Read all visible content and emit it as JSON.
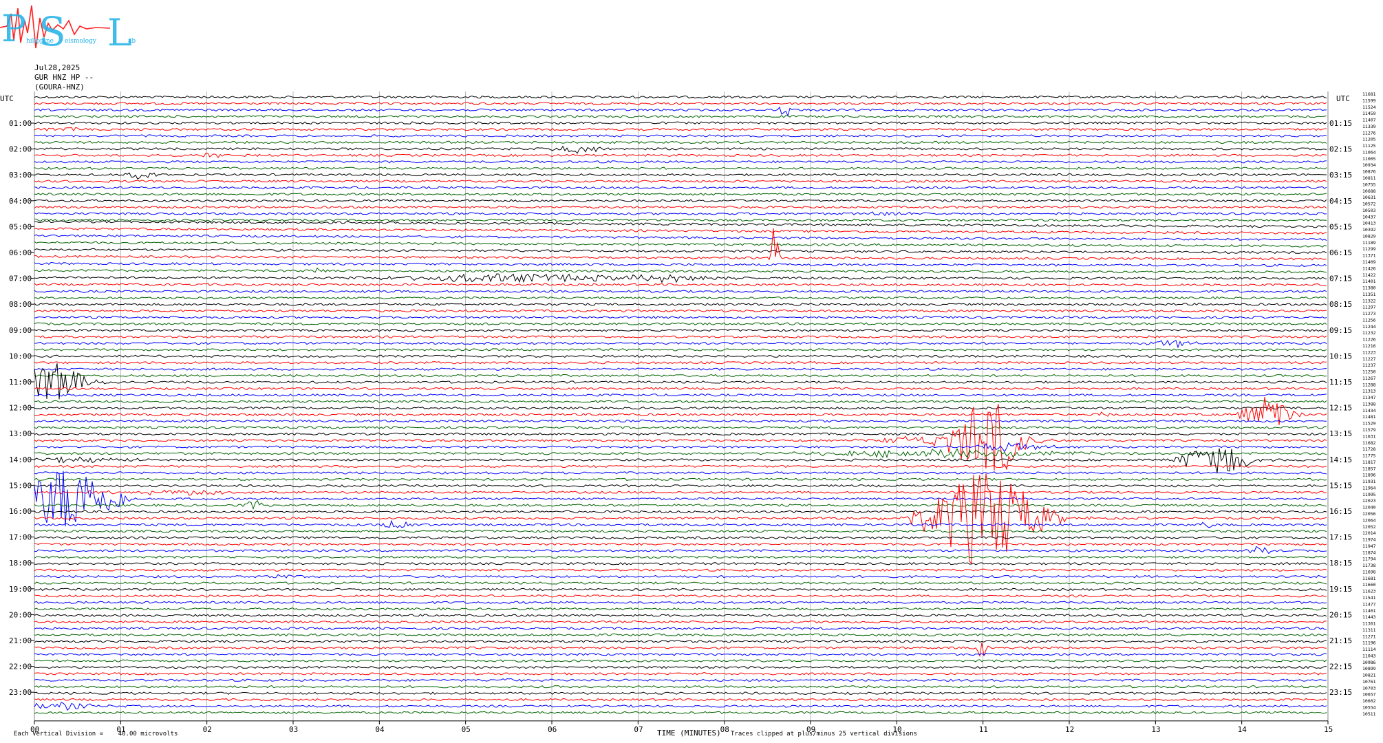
{
  "logo": {
    "letters": [
      "P",
      "S",
      "L"
    ],
    "subtitle_fragments": [
      "hilippine",
      "eismology",
      "ab"
    ]
  },
  "header": {
    "date": "Jul28,2025",
    "channel": "GUR HNZ HP --",
    "station": "(GOURA-HNZ)"
  },
  "footer": {
    "left_note": "Each Vertical Division =    40.00 microvolts",
    "xlabel": "TIME (MINUTES)",
    "clip_note": "Traces clipped at plus/minus 25 vertical divisions"
  },
  "colors": {
    "trace_cycle": [
      "#000000",
      "#ff0000",
      "#0000ff",
      "#006400"
    ],
    "grid": "#9a9a9a",
    "logo_blue": "#1fb0e8",
    "logo_red": "#ff2020"
  },
  "chart_data": {
    "type": "line",
    "title": "Jul28,2025",
    "xlabel": "TIME (MINUTES)",
    "ylabel": "",
    "left_axis_title": "UTC",
    "right_axis_title": "UTC",
    "xlim": [
      0,
      15
    ],
    "x_ticks": [
      "00",
      "01",
      "02",
      "03",
      "04",
      "05",
      "06",
      "07",
      "08",
      "09",
      "10",
      "11",
      "12",
      "13",
      "14",
      "15"
    ],
    "left_hour_labels": [
      "01:00",
      "02:00",
      "03:00",
      "04:00",
      "05:00",
      "06:00",
      "07:00",
      "08:00",
      "09:00",
      "10:00",
      "11:00",
      "12:00",
      "13:00",
      "14:00",
      "15:00",
      "16:00",
      "17:00",
      "18:00",
      "19:00",
      "20:00",
      "21:00",
      "22:00",
      "23:00"
    ],
    "right_hour_labels": [
      "01:15",
      "02:15",
      "03:15",
      "04:15",
      "05:15",
      "06:15",
      "07:15",
      "08:15",
      "09:15",
      "10:15",
      "11:15",
      "12:15",
      "13:15",
      "14:15",
      "15:15",
      "16:15",
      "17:15",
      "18:15",
      "19:15",
      "20:15",
      "21:15",
      "22:15",
      "23:15"
    ],
    "trace_minutes": 15,
    "traces_count": 96,
    "grid": true,
    "offset_labels": [
      "11681",
      "11599",
      "11524",
      "11459",
      "11407",
      "11339",
      "11276",
      "11205",
      "11125",
      "11064",
      "11005",
      "10934",
      "10876",
      "10811",
      "10755",
      "10688",
      "10631",
      "10572",
      "10503",
      "10437",
      "10413",
      "10392",
      "10829",
      "11189",
      "11299",
      "11371",
      "11409",
      "11426",
      "11422",
      "11401",
      "11380",
      "11351",
      "11322",
      "11297",
      "11273",
      "11256",
      "11244",
      "11232",
      "11226",
      "11216",
      "11223",
      "11227",
      "11237",
      "11250",
      "11267",
      "11288",
      "11313",
      "11347",
      "11388",
      "11434",
      "11481",
      "11529",
      "11579",
      "11631",
      "11682",
      "11728",
      "11775",
      "11817",
      "11857",
      "11896",
      "11931",
      "11964",
      "11995",
      "12023",
      "12040",
      "12056",
      "12064",
      "12052",
      "12014",
      "11974",
      "11947",
      "11874",
      "11794",
      "11738",
      "11698",
      "11681",
      "11660",
      "11623",
      "11541",
      "11477",
      "11401",
      "11443",
      "11361",
      "11311",
      "11271",
      "11196",
      "11114",
      "11043",
      "10986",
      "10899",
      "10821",
      "10761",
      "10703",
      "10657",
      "10602",
      "10554",
      "10511"
    ],
    "events": [
      {
        "trace": 2,
        "minute": 8.7,
        "amp": 14,
        "width": 0.05
      },
      {
        "trace": 5,
        "minute": 0.3,
        "amp": 3,
        "width": 0.3
      },
      {
        "trace": 8,
        "minute": 6.3,
        "amp": 6,
        "width": 0.25
      },
      {
        "trace": 9,
        "minute": 2.05,
        "amp": 5,
        "width": 0.1
      },
      {
        "trace": 12,
        "minute": 1.25,
        "amp": 7,
        "width": 0.15
      },
      {
        "trace": 14,
        "minute": 14.7,
        "amp": 4,
        "width": 0.05
      },
      {
        "trace": 18,
        "minute": 9.9,
        "amp": 4,
        "width": 0.2
      },
      {
        "trace": 25,
        "minute": 8.58,
        "amp": 50,
        "width": 0.04
      },
      {
        "trace": 27,
        "minute": 3.3,
        "amp": 4,
        "width": 0.08
      },
      {
        "trace": 28,
        "minute": 5.5,
        "amp": 6,
        "width": 1.4
      },
      {
        "trace": 28,
        "minute": 7.4,
        "amp": 5,
        "width": 0.6
      },
      {
        "trace": 30,
        "minute": 3.9,
        "amp": 4,
        "width": 0.1
      },
      {
        "trace": 38,
        "minute": 13.2,
        "amp": 6,
        "width": 0.2
      },
      {
        "trace": 44,
        "minute": 0.2,
        "amp": 30,
        "width": 0.35
      },
      {
        "trace": 49,
        "minute": 12.4,
        "amp": 5,
        "width": 0.06
      },
      {
        "trace": 49,
        "minute": 14.3,
        "amp": 28,
        "width": 0.25
      },
      {
        "trace": 53,
        "minute": 11.05,
        "amp": 60,
        "width": 0.35
      },
      {
        "trace": 53,
        "minute": 10.6,
        "amp": 8,
        "width": 0.8
      },
      {
        "trace": 54,
        "minute": 11.3,
        "amp": 6,
        "width": 0.4
      },
      {
        "trace": 55,
        "minute": 10.5,
        "amp": 6,
        "width": 1.3
      },
      {
        "trace": 56,
        "minute": 13.7,
        "amp": 26,
        "width": 0.35
      },
      {
        "trace": 56,
        "minute": 0.5,
        "amp": 4,
        "width": 0.6
      },
      {
        "trace": 61,
        "minute": 1.7,
        "amp": 3,
        "width": 1.2
      },
      {
        "trace": 62,
        "minute": 0.4,
        "amp": 50,
        "width": 0.5
      },
      {
        "trace": 63,
        "minute": 2.55,
        "amp": 8,
        "width": 0.08
      },
      {
        "trace": 65,
        "minute": 11.0,
        "amp": 70,
        "width": 0.6
      },
      {
        "trace": 66,
        "minute": 4.2,
        "amp": 6,
        "width": 0.2
      },
      {
        "trace": 66,
        "minute": 13.6,
        "amp": 6,
        "width": 0.05
      },
      {
        "trace": 70,
        "minute": 14.2,
        "amp": 6,
        "width": 0.15
      },
      {
        "trace": 74,
        "minute": 2.9,
        "amp": 4,
        "width": 0.1
      },
      {
        "trace": 85,
        "minute": 11.0,
        "amp": 20,
        "width": 0.05
      },
      {
        "trace": 90,
        "minute": 5.5,
        "amp": 5,
        "width": 0.05
      },
      {
        "trace": 94,
        "minute": 0.3,
        "amp": 5,
        "width": 0.4
      }
    ]
  }
}
